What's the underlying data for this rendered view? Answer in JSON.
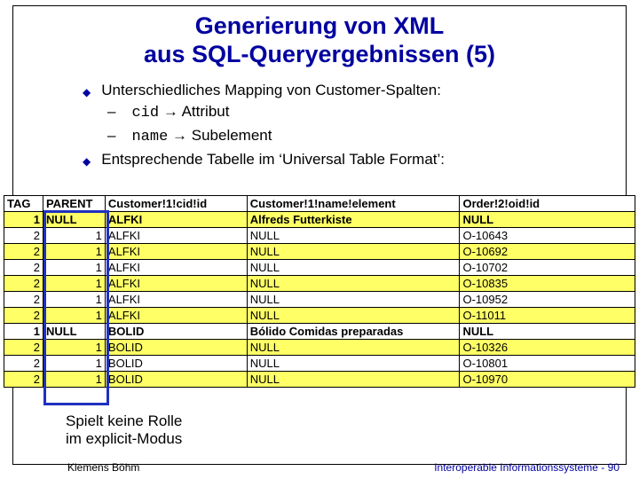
{
  "title_line1": "Generierung von XML",
  "title_line2": "aus SQL-Queryergebnissen (5)",
  "bullets": {
    "b1": "Unterschiedliches Mapping von Customer-Spalten:",
    "s1_code": "cid",
    "s1_rest": " Attribut",
    "s2_code": "name",
    "s2_rest": " Subelement",
    "b2": "Entsprechende Tabelle im ‘Universal Table Format’:"
  },
  "caption_line1": "Spielt keine Rolle",
  "caption_line2": "im explicit-Modus",
  "footer_left": "Klemens Böhm",
  "footer_right": "Interoperable Informationssysteme - 90",
  "chart_data": {
    "type": "table",
    "columns": [
      "TAG",
      "PARENT",
      "Customer!1!cid!id",
      "Customer!1!name!element",
      "Order!2!oid!id"
    ],
    "rows": [
      {
        "tag": "1",
        "parent": "NULL",
        "cid": "ALFKI",
        "name": "Alfreds Futterkiste",
        "oid": "NULL"
      },
      {
        "tag": "2",
        "parent": "1",
        "cid": "ALFKI",
        "name": "NULL",
        "oid": "O-10643"
      },
      {
        "tag": "2",
        "parent": "1",
        "cid": "ALFKI",
        "name": "NULL",
        "oid": "O-10692"
      },
      {
        "tag": "2",
        "parent": "1",
        "cid": "ALFKI",
        "name": "NULL",
        "oid": "O-10702"
      },
      {
        "tag": "2",
        "parent": "1",
        "cid": "ALFKI",
        "name": "NULL",
        "oid": "O-10835"
      },
      {
        "tag": "2",
        "parent": "1",
        "cid": "ALFKI",
        "name": "NULL",
        "oid": "O-10952"
      },
      {
        "tag": "2",
        "parent": "1",
        "cid": "ALFKI",
        "name": "NULL",
        "oid": "O-11011"
      },
      {
        "tag": "1",
        "parent": "NULL",
        "cid": "BOLID",
        "name": "Bólido Comidas preparadas",
        "oid": "NULL"
      },
      {
        "tag": "2",
        "parent": "1",
        "cid": "BOLID",
        "name": "NULL",
        "oid": "O-10326"
      },
      {
        "tag": "2",
        "parent": "1",
        "cid": "BOLID",
        "name": "NULL",
        "oid": "O-10801"
      },
      {
        "tag": "2",
        "parent": "1",
        "cid": "BOLID",
        "name": "NULL",
        "oid": "O-10970"
      }
    ]
  }
}
